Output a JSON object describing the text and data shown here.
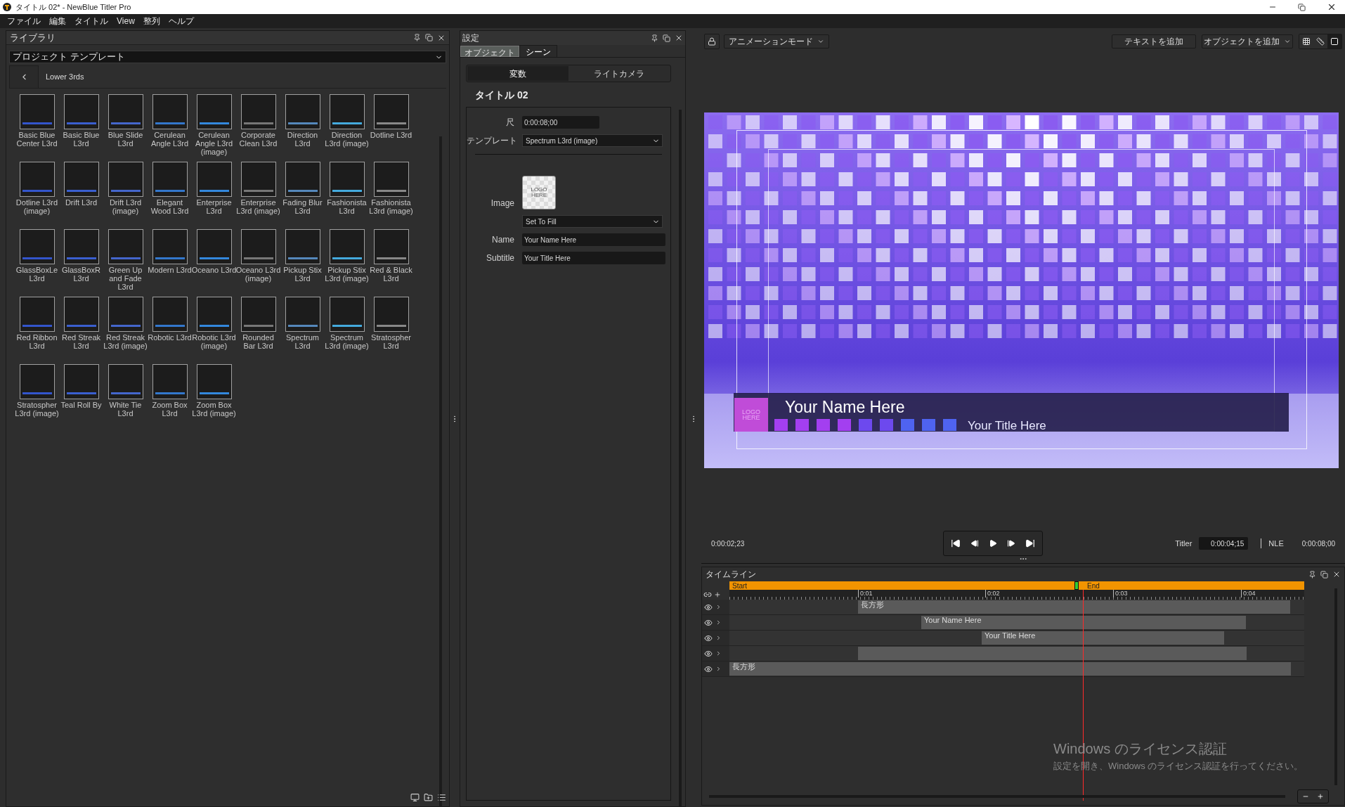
{
  "window": {
    "title": "タイトル 02* - NewBlue Titler Pro"
  },
  "menu": [
    "ファイル",
    "編集",
    "タイトル",
    "View",
    "整列",
    "ヘルプ"
  ],
  "library": {
    "title": "ライブラリ",
    "source": "プロジェクト テンプレート",
    "folder": "Lower 3rds",
    "items": [
      {
        "label": "Basic Blue Center L3rd"
      },
      {
        "label": "Basic Blue L3rd"
      },
      {
        "label": "Blue Slide L3rd"
      },
      {
        "label": "Cerulean Angle L3rd"
      },
      {
        "label": "Cerulean Angle L3rd (image)"
      },
      {
        "label": "Corporate Clean L3rd"
      },
      {
        "label": "Direction L3rd"
      },
      {
        "label": "Direction L3rd (image)"
      },
      {
        "label": "Dotline L3rd"
      },
      {
        "label": "Dotline L3rd (image)"
      },
      {
        "label": "Drift L3rd"
      },
      {
        "label": "Drift L3rd (image)"
      },
      {
        "label": "Elegant Wood L3rd"
      },
      {
        "label": "Enterprise L3rd"
      },
      {
        "label": "Enterprise L3rd (image)"
      },
      {
        "label": "Fading Blur L3rd"
      },
      {
        "label": "Fashionista L3rd"
      },
      {
        "label": "Fashionista L3rd (image)"
      },
      {
        "label": "GlassBoxLe L3rd"
      },
      {
        "label": "GlassBoxR L3rd"
      },
      {
        "label": "Green Up and Fade L3rd"
      },
      {
        "label": "Modern L3rd"
      },
      {
        "label": "Oceano L3rd"
      },
      {
        "label": "Oceano L3rd (image)"
      },
      {
        "label": "Pickup Stix L3rd"
      },
      {
        "label": "Pickup Stix L3rd (image)"
      },
      {
        "label": "Red & Black L3rd"
      },
      {
        "label": "Red Ribbon L3rd"
      },
      {
        "label": "Red Streak L3rd"
      },
      {
        "label": "Red Streak L3rd (image)"
      },
      {
        "label": "Robotic L3rd"
      },
      {
        "label": "Robotic L3rd (image)"
      },
      {
        "label": "Rounded Bar L3rd"
      },
      {
        "label": "Spectrum L3rd"
      },
      {
        "label": "Spectrum L3rd (image)"
      },
      {
        "label": "Stratospher L3rd"
      },
      {
        "label": "Stratospher L3rd (image)"
      },
      {
        "label": "Teal Roll By"
      },
      {
        "label": "White Tie L3rd"
      },
      {
        "label": "Zoom Box L3rd"
      },
      {
        "label": "Zoom Box L3rd (image)"
      }
    ]
  },
  "settings": {
    "title": "設定",
    "tabs": [
      {
        "label": "オブジェクト",
        "selected": false
      },
      {
        "label": "シーン",
        "selected": true
      }
    ],
    "subtabs": [
      {
        "label": "変数",
        "selected": true
      },
      {
        "label": "ライトカメラ",
        "selected": false
      }
    ],
    "heading": "タイトル 02",
    "fields": [
      {
        "kind": "text",
        "label": "尺",
        "value": "0:00:08;00"
      },
      {
        "kind": "dropdown",
        "label": "テンプレート",
        "value": "Spectrum L3rd (image)"
      },
      {
        "kind": "image",
        "label": "Image",
        "thumb_text": "LOGO HERE"
      },
      {
        "kind": "dropdown",
        "value": "Set To Fill"
      },
      {
        "kind": "wide",
        "label": "Name",
        "value": "Your Name Here"
      },
      {
        "kind": "wide",
        "label": "Subtitle",
        "value": "Your Title Here"
      }
    ]
  },
  "toolbar": {
    "mode": "アニメーションモード",
    "add_text": "テキストを追加",
    "add_object": "オブジェクトを追加",
    "views": [
      {
        "kind": "grid",
        "selected": false
      },
      {
        "kind": "ruler",
        "selected": false
      },
      {
        "kind": "frame",
        "selected": true
      }
    ]
  },
  "preview": {
    "logo_text": "LOGO HERE",
    "name_text": "Your Name Here",
    "title_text": "Your Title Here"
  },
  "transport": {
    "current": "0:00:02;23",
    "titler_label": "Titler",
    "titler_time": "0:00:04;15",
    "nle_label": "NLE",
    "nle_time": "0:00:08;00"
  },
  "timeline": {
    "title": "タイムライン",
    "start": "Start",
    "end": "End",
    "ticks": [
      "0:01",
      "0:02",
      "0:03",
      "0:04"
    ],
    "tracks": [
      {
        "kind": "labeled",
        "label": "長方形"
      },
      {
        "kind": "labeled",
        "label": "Your Name Here"
      },
      {
        "kind": "labeled",
        "label": "Your Title Here"
      },
      {
        "kind": "blank"
      },
      {
        "kind": "labeled",
        "label": "長方形"
      }
    ]
  },
  "activation": {
    "title": "Windows のライセンス認証",
    "message": "設定を開き、Windows のライセンス認証を行ってください。"
  }
}
